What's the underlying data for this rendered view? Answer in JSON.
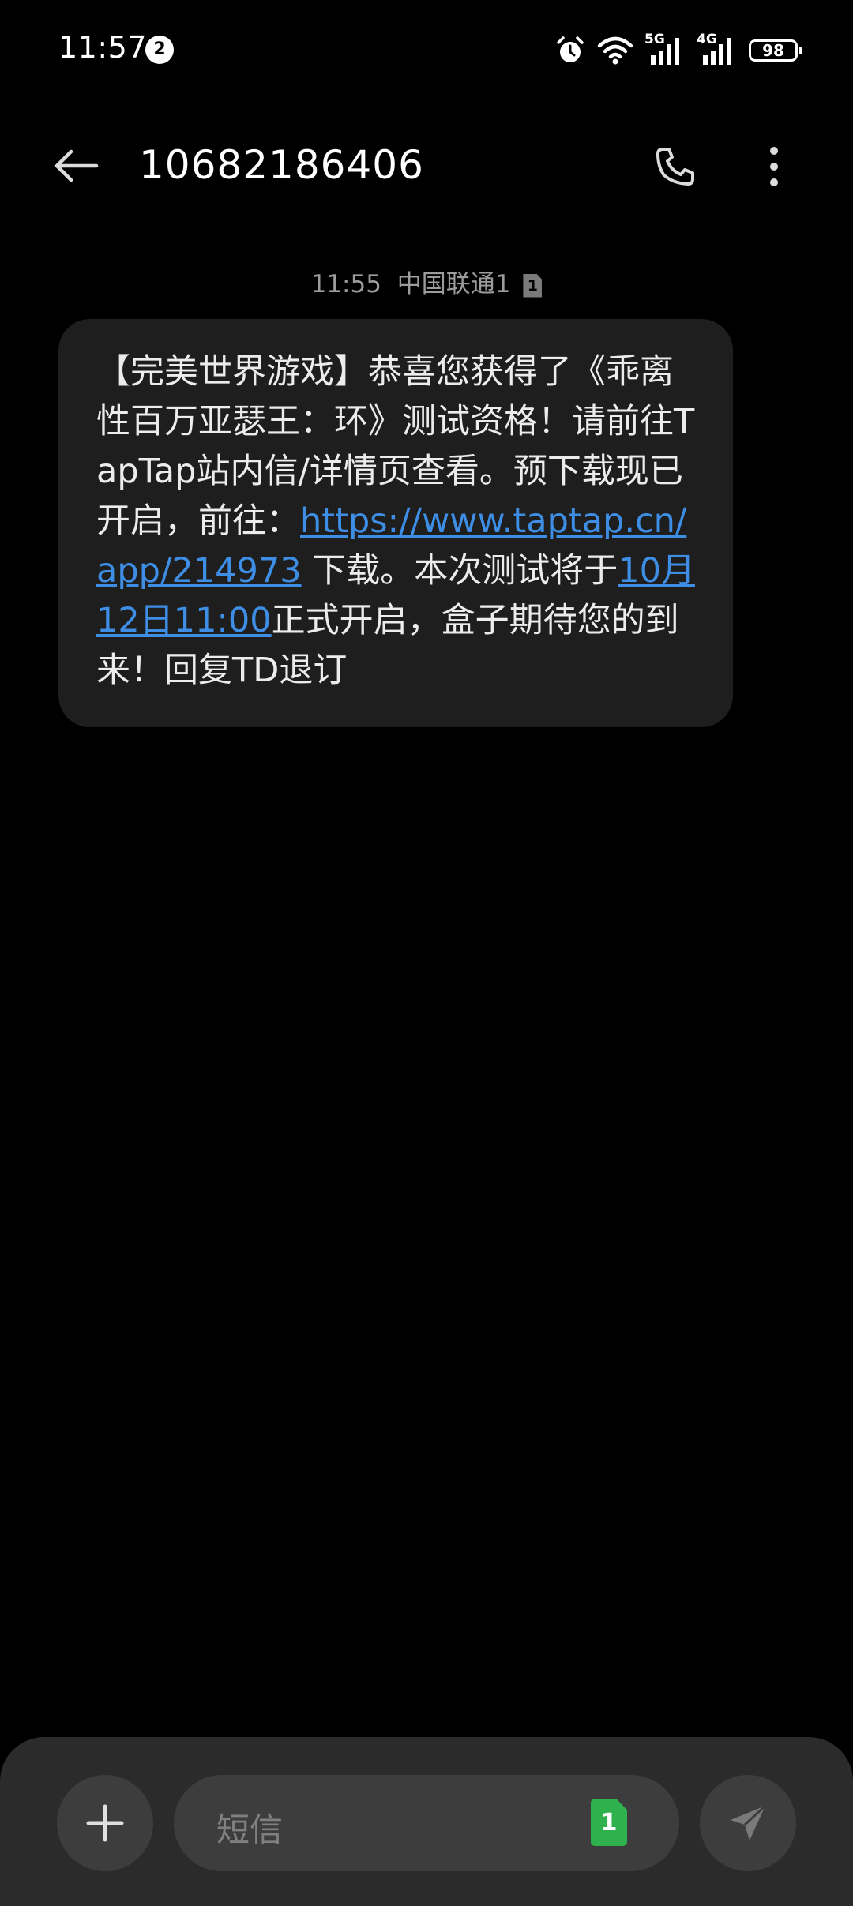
{
  "status_bar": {
    "time": "11:57",
    "notification_count": "2",
    "network_labels": [
      "5G",
      "4G"
    ],
    "battery_level": "98",
    "icons": [
      "alarm-icon",
      "wifi-icon",
      "signal-5g-icon",
      "signal-4g-icon",
      "battery-icon"
    ]
  },
  "header": {
    "contact": "10682186406",
    "icons": [
      "back-arrow-icon",
      "phone-icon",
      "more-vertical-icon"
    ]
  },
  "message": {
    "time": "11:55",
    "carrier": "中国联通1",
    "sim_number": "1",
    "text_part1": "【完美世界游戏】恭喜您获得了《乖离性百万亚瑟王：环》测试资格！请前往TapTap站内信/详情页查看。预下载现已开启，前往：",
    "link_url": "https://www.taptap.cn/app/214973",
    "text_part2": " 下载。本次测试将于",
    "link_date": "10月12日11:00",
    "text_part3": "正式开启，盒子期待您的到来！回复TD退订"
  },
  "compose": {
    "placeholder": "短信",
    "sim_number": "1",
    "icons": [
      "plus-icon",
      "sim-card-icon",
      "send-icon"
    ]
  },
  "colors": {
    "background": "#000000",
    "bubble": "#1e1e1e",
    "link": "#3e8ee6",
    "compose_bar": "#2b2b2b",
    "sim_green": "#2fb24d"
  }
}
